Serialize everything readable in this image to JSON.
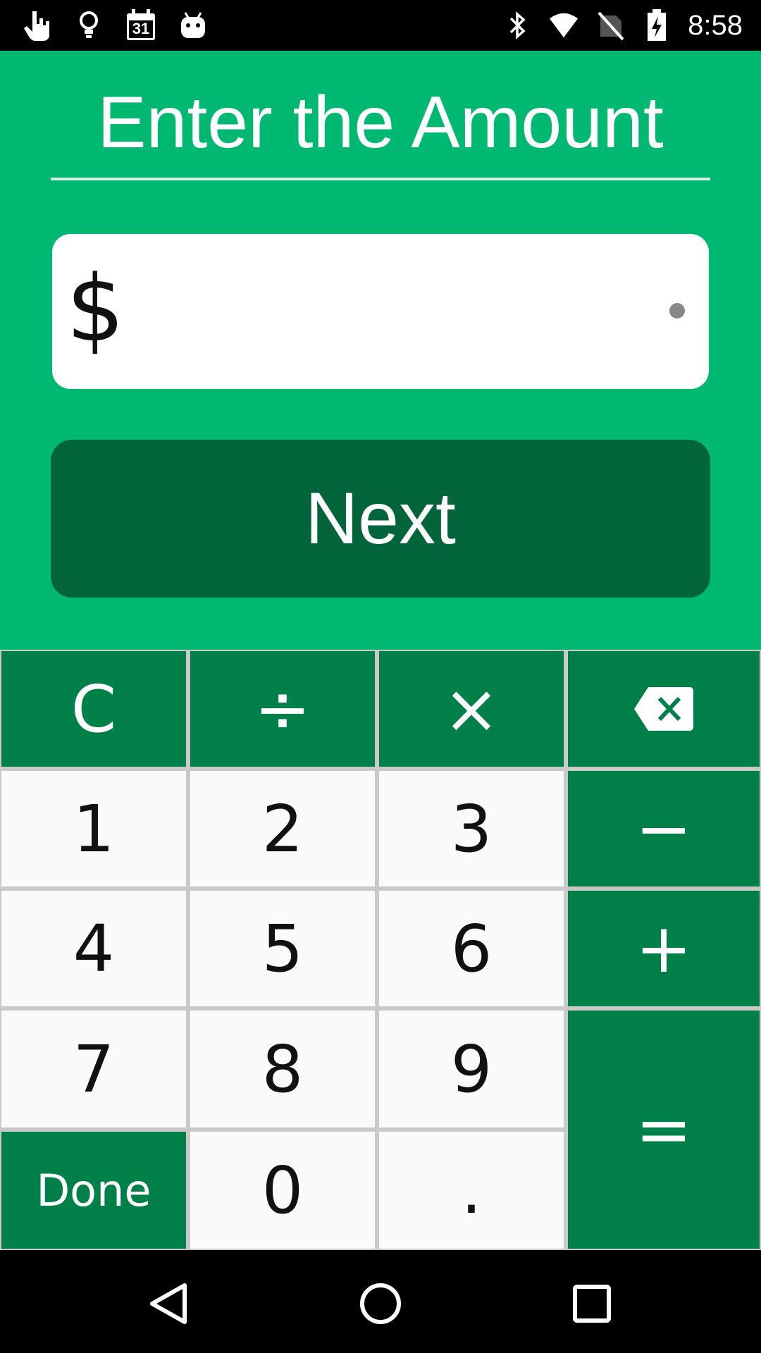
{
  "status_bar": {
    "time": "8:58",
    "calendar_day": "31",
    "left_icons": [
      "touch-icon",
      "lightbulb-icon",
      "calendar-icon",
      "android-icon"
    ],
    "right_icons": [
      "bluetooth-icon",
      "wifi-icon",
      "no-sim-icon",
      "battery-charging-icon"
    ]
  },
  "main": {
    "title": "Enter the Amount",
    "currency_symbol": "$",
    "amount_value": "",
    "next_label": "Next"
  },
  "keypad": {
    "clear": "C",
    "divide": "÷",
    "multiply": "×",
    "backspace_icon": "backspace-icon",
    "k1": "1",
    "k2": "2",
    "k3": "3",
    "minus": "−",
    "k4": "4",
    "k5": "5",
    "k6": "6",
    "plus": "+",
    "k7": "7",
    "k8": "8",
    "k9": "9",
    "equals": "=",
    "done": "Done",
    "k0": "0",
    "decimal": ".",
    "colors": {
      "operator": "#008049",
      "number": "#fafafa",
      "divider": "#c9c9c9"
    }
  },
  "colors": {
    "background": "#00b871",
    "next_button": "#02643a",
    "field": "#ffffff"
  },
  "nav_bar": {
    "icons": [
      "back-icon",
      "home-icon",
      "recents-icon"
    ]
  }
}
